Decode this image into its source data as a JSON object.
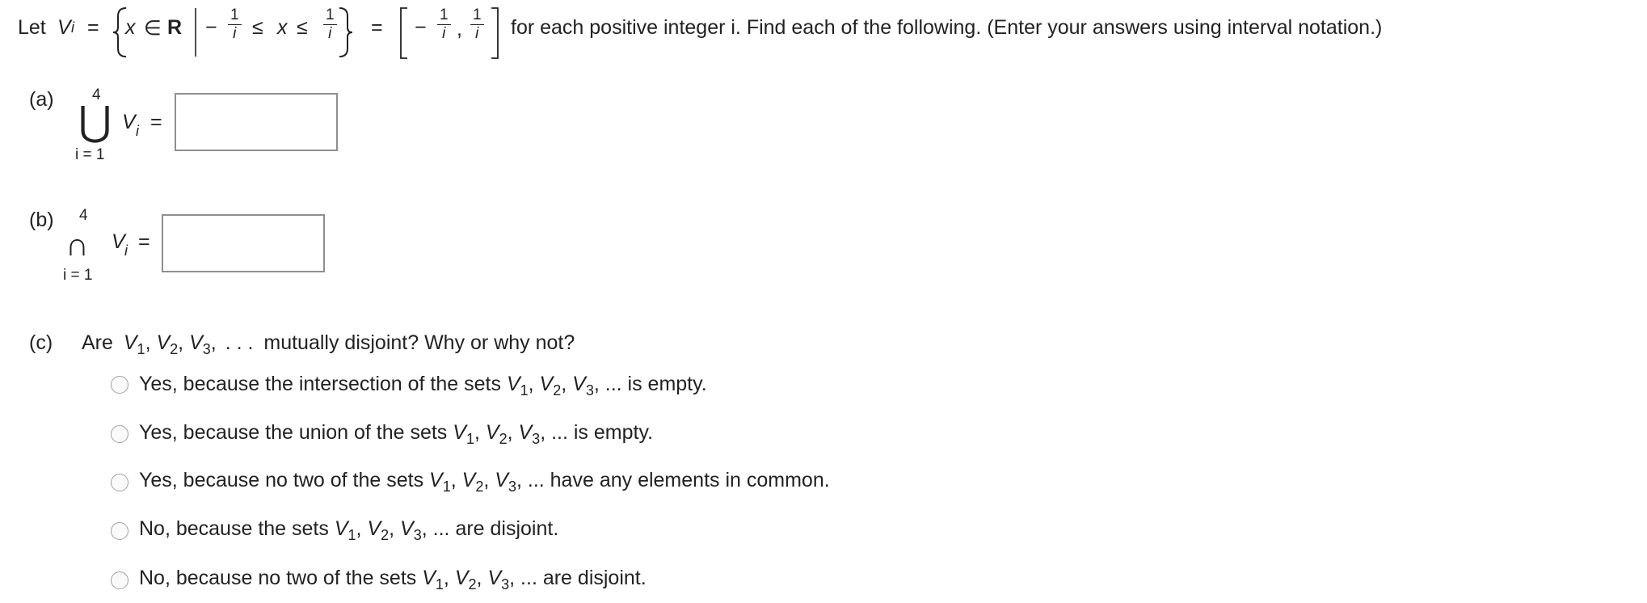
{
  "problem": {
    "intro_let": "Let",
    "set_var": "V",
    "set_var_sub": "i",
    "equals": "=",
    "x_var": "x",
    "elem_of": "∈",
    "reals": "R",
    "minus": "−",
    "frac_num": "1",
    "frac_den": "i",
    "leq": "≤",
    "comma": ",",
    "statement": "for each positive integer i. Find each of the following. (Enter your answers using interval notation.)"
  },
  "part_a": {
    "label": "(a)",
    "upper_limit": "4",
    "operator": "⋃",
    "lower_limit": "i = 1",
    "set_var": "V",
    "set_sub": "i",
    "equals": "=",
    "answer_value": ""
  },
  "part_b": {
    "label": "(b)",
    "upper_limit": "4",
    "operator": "∩",
    "lower_limit": "i = 1",
    "set_var": "V",
    "set_sub": "i",
    "equals": "=",
    "answer_value": ""
  },
  "part_c": {
    "label": "(c)",
    "question_prefix": "Are",
    "sets": [
      "V",
      "V",
      "V"
    ],
    "set_subs": [
      "1",
      "2",
      "3"
    ],
    "ellipsis": ". . .",
    "question_suffix": "mutually disjoint? Why or why not?",
    "options": [
      {
        "prefix": "Yes, because the intersection of the sets",
        "suffix": "... is empty."
      },
      {
        "prefix": "Yes, because the union of the sets",
        "suffix": "... is empty."
      },
      {
        "prefix": "Yes, because no two of the sets",
        "suffix": "... have any elements in common."
      },
      {
        "prefix": "No, because the sets",
        "suffix": "... are disjoint."
      },
      {
        "prefix": "No, because no two of the sets",
        "suffix": "... are disjoint."
      }
    ]
  }
}
